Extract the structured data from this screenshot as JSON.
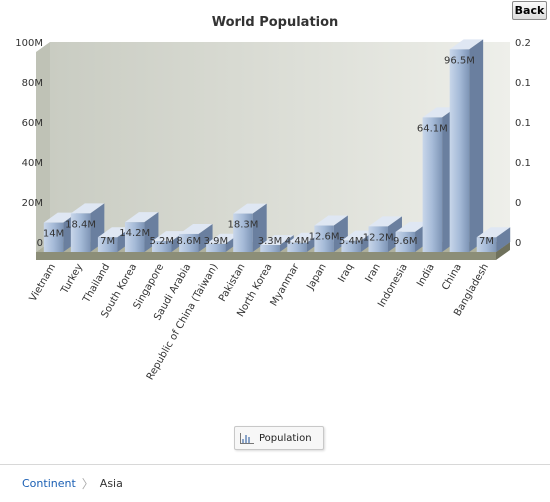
{
  "back_button": "Back",
  "legend": {
    "label": "Population",
    "icon": "bar-chart-icon"
  },
  "breadcrumb": {
    "root": "Continent",
    "separator": "〉",
    "current": "Asia"
  },
  "chart_data": {
    "type": "bar",
    "title": "World Population",
    "xlabel": "",
    "ylabel": "",
    "ylim": [
      0,
      100000000
    ],
    "y_ticks": [
      "0",
      "20M",
      "40M",
      "60M",
      "80M",
      "100M"
    ],
    "y2_ticks": [
      "0",
      "0",
      "0.1",
      "0.1",
      "0.1",
      "0.2"
    ],
    "categories": [
      "Vietnam",
      "Turkey",
      "Thailand",
      "South Korea",
      "Singapore",
      "Saudi Arabia",
      "Republic of China (Taiwan)",
      "Pakistan",
      "North Korea",
      "Myanmar",
      "Japan",
      "Iraq",
      "Iran",
      "Indonesia",
      "India",
      "China",
      "Bangladesh"
    ],
    "series": [
      {
        "name": "Population",
        "values": [
          14000000,
          18400000,
          7000000,
          14200000,
          5200000,
          8600000,
          3900000,
          18300000,
          3300000,
          4400000,
          12600000,
          5400000,
          12200000,
          9600000,
          64100000,
          96500000,
          7000000
        ],
        "labels": [
          "14M",
          "18.4M",
          "7M",
          "14.2M",
          "5.2M",
          "8.6M",
          "3.9M",
          "18.3M",
          "3.3M",
          "4.4M",
          "12.6M",
          "5.4M",
          "12.2M",
          "9.6M",
          "64.1M",
          "96.5M",
          "7M"
        ]
      }
    ],
    "grid": false,
    "legend_position": "bottom"
  }
}
